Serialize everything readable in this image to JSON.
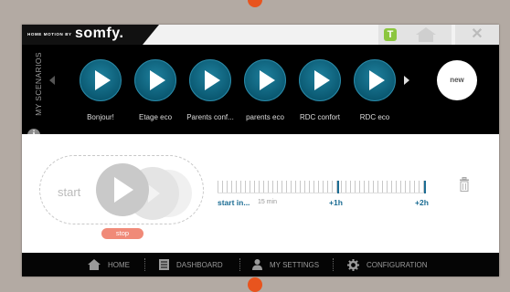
{
  "topbar": {
    "brand_small": "HOME MOTION BY",
    "brand": "somfy.",
    "t_icon": "T",
    "close_glyph": "✕"
  },
  "scenarios": {
    "label": "MY SCENARIOS",
    "items": [
      {
        "label": "Bonjour!"
      },
      {
        "label": "Etage eco"
      },
      {
        "label": "Parents conf..."
      },
      {
        "label": "parents eco"
      },
      {
        "label": "RDC confort"
      },
      {
        "label": "RDC eco"
      }
    ],
    "new_label": "new",
    "info_glyph": "i"
  },
  "player": {
    "start_label": "start",
    "stop_label": "stop"
  },
  "timeline": {
    "start_label": "start in...",
    "min_label": "15 min",
    "mark1_label": "+1h",
    "mark2_label": "+2h"
  },
  "nav": [
    {
      "label": "HOME",
      "icon": "house-icon"
    },
    {
      "label": "DASHBOARD",
      "icon": "dashboard-icon"
    },
    {
      "label": "MY SETTINGS",
      "icon": "person-icon"
    },
    {
      "label": "CONFIGURATION",
      "icon": "gear-icon"
    }
  ],
  "colors": {
    "accent": "#1b6c93",
    "scenario_blue": "#0b5a73",
    "stop": "#f08a78",
    "green": "#8cc63f",
    "orange": "#e8541e"
  }
}
